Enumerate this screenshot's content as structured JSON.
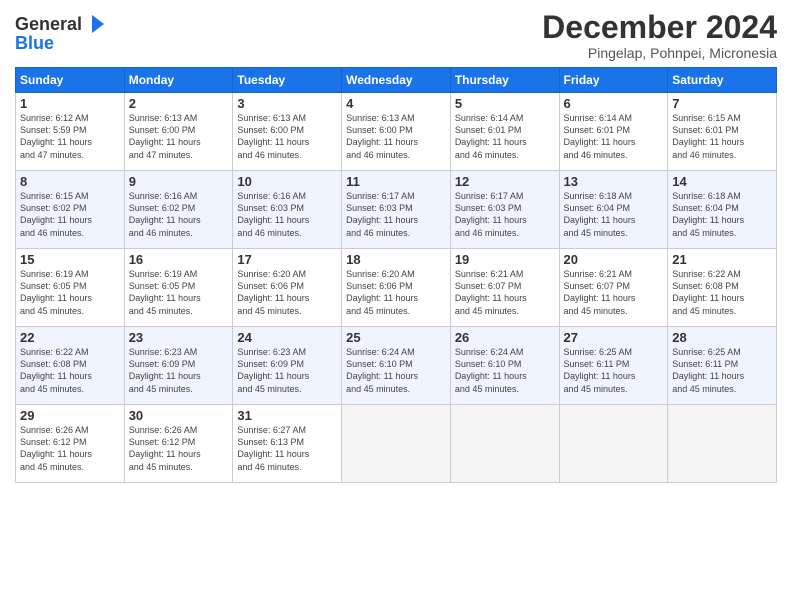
{
  "header": {
    "logo_line1": "General",
    "logo_line2": "Blue",
    "month": "December 2024",
    "location": "Pingelap, Pohnpei, Micronesia"
  },
  "weekdays": [
    "Sunday",
    "Monday",
    "Tuesday",
    "Wednesday",
    "Thursday",
    "Friday",
    "Saturday"
  ],
  "weeks": [
    [
      {
        "day": "1",
        "info": "Sunrise: 6:12 AM\nSunset: 5:59 PM\nDaylight: 11 hours\nand 47 minutes."
      },
      {
        "day": "2",
        "info": "Sunrise: 6:13 AM\nSunset: 6:00 PM\nDaylight: 11 hours\nand 47 minutes."
      },
      {
        "day": "3",
        "info": "Sunrise: 6:13 AM\nSunset: 6:00 PM\nDaylight: 11 hours\nand 46 minutes."
      },
      {
        "day": "4",
        "info": "Sunrise: 6:13 AM\nSunset: 6:00 PM\nDaylight: 11 hours\nand 46 minutes."
      },
      {
        "day": "5",
        "info": "Sunrise: 6:14 AM\nSunset: 6:01 PM\nDaylight: 11 hours\nand 46 minutes."
      },
      {
        "day": "6",
        "info": "Sunrise: 6:14 AM\nSunset: 6:01 PM\nDaylight: 11 hours\nand 46 minutes."
      },
      {
        "day": "7",
        "info": "Sunrise: 6:15 AM\nSunset: 6:01 PM\nDaylight: 11 hours\nand 46 minutes."
      }
    ],
    [
      {
        "day": "8",
        "info": "Sunrise: 6:15 AM\nSunset: 6:02 PM\nDaylight: 11 hours\nand 46 minutes."
      },
      {
        "day": "9",
        "info": "Sunrise: 6:16 AM\nSunset: 6:02 PM\nDaylight: 11 hours\nand 46 minutes."
      },
      {
        "day": "10",
        "info": "Sunrise: 6:16 AM\nSunset: 6:03 PM\nDaylight: 11 hours\nand 46 minutes."
      },
      {
        "day": "11",
        "info": "Sunrise: 6:17 AM\nSunset: 6:03 PM\nDaylight: 11 hours\nand 46 minutes."
      },
      {
        "day": "12",
        "info": "Sunrise: 6:17 AM\nSunset: 6:03 PM\nDaylight: 11 hours\nand 46 minutes."
      },
      {
        "day": "13",
        "info": "Sunrise: 6:18 AM\nSunset: 6:04 PM\nDaylight: 11 hours\nand 45 minutes."
      },
      {
        "day": "14",
        "info": "Sunrise: 6:18 AM\nSunset: 6:04 PM\nDaylight: 11 hours\nand 45 minutes."
      }
    ],
    [
      {
        "day": "15",
        "info": "Sunrise: 6:19 AM\nSunset: 6:05 PM\nDaylight: 11 hours\nand 45 minutes."
      },
      {
        "day": "16",
        "info": "Sunrise: 6:19 AM\nSunset: 6:05 PM\nDaylight: 11 hours\nand 45 minutes."
      },
      {
        "day": "17",
        "info": "Sunrise: 6:20 AM\nSunset: 6:06 PM\nDaylight: 11 hours\nand 45 minutes."
      },
      {
        "day": "18",
        "info": "Sunrise: 6:20 AM\nSunset: 6:06 PM\nDaylight: 11 hours\nand 45 minutes."
      },
      {
        "day": "19",
        "info": "Sunrise: 6:21 AM\nSunset: 6:07 PM\nDaylight: 11 hours\nand 45 minutes."
      },
      {
        "day": "20",
        "info": "Sunrise: 6:21 AM\nSunset: 6:07 PM\nDaylight: 11 hours\nand 45 minutes."
      },
      {
        "day": "21",
        "info": "Sunrise: 6:22 AM\nSunset: 6:08 PM\nDaylight: 11 hours\nand 45 minutes."
      }
    ],
    [
      {
        "day": "22",
        "info": "Sunrise: 6:22 AM\nSunset: 6:08 PM\nDaylight: 11 hours\nand 45 minutes."
      },
      {
        "day": "23",
        "info": "Sunrise: 6:23 AM\nSunset: 6:09 PM\nDaylight: 11 hours\nand 45 minutes."
      },
      {
        "day": "24",
        "info": "Sunrise: 6:23 AM\nSunset: 6:09 PM\nDaylight: 11 hours\nand 45 minutes."
      },
      {
        "day": "25",
        "info": "Sunrise: 6:24 AM\nSunset: 6:10 PM\nDaylight: 11 hours\nand 45 minutes."
      },
      {
        "day": "26",
        "info": "Sunrise: 6:24 AM\nSunset: 6:10 PM\nDaylight: 11 hours\nand 45 minutes."
      },
      {
        "day": "27",
        "info": "Sunrise: 6:25 AM\nSunset: 6:11 PM\nDaylight: 11 hours\nand 45 minutes."
      },
      {
        "day": "28",
        "info": "Sunrise: 6:25 AM\nSunset: 6:11 PM\nDaylight: 11 hours\nand 45 minutes."
      }
    ],
    [
      {
        "day": "29",
        "info": "Sunrise: 6:26 AM\nSunset: 6:12 PM\nDaylight: 11 hours\nand 45 minutes."
      },
      {
        "day": "30",
        "info": "Sunrise: 6:26 AM\nSunset: 6:12 PM\nDaylight: 11 hours\nand 45 minutes."
      },
      {
        "day": "31",
        "info": "Sunrise: 6:27 AM\nSunset: 6:13 PM\nDaylight: 11 hours\nand 46 minutes."
      },
      {
        "day": "",
        "info": ""
      },
      {
        "day": "",
        "info": ""
      },
      {
        "day": "",
        "info": ""
      },
      {
        "day": "",
        "info": ""
      }
    ]
  ]
}
